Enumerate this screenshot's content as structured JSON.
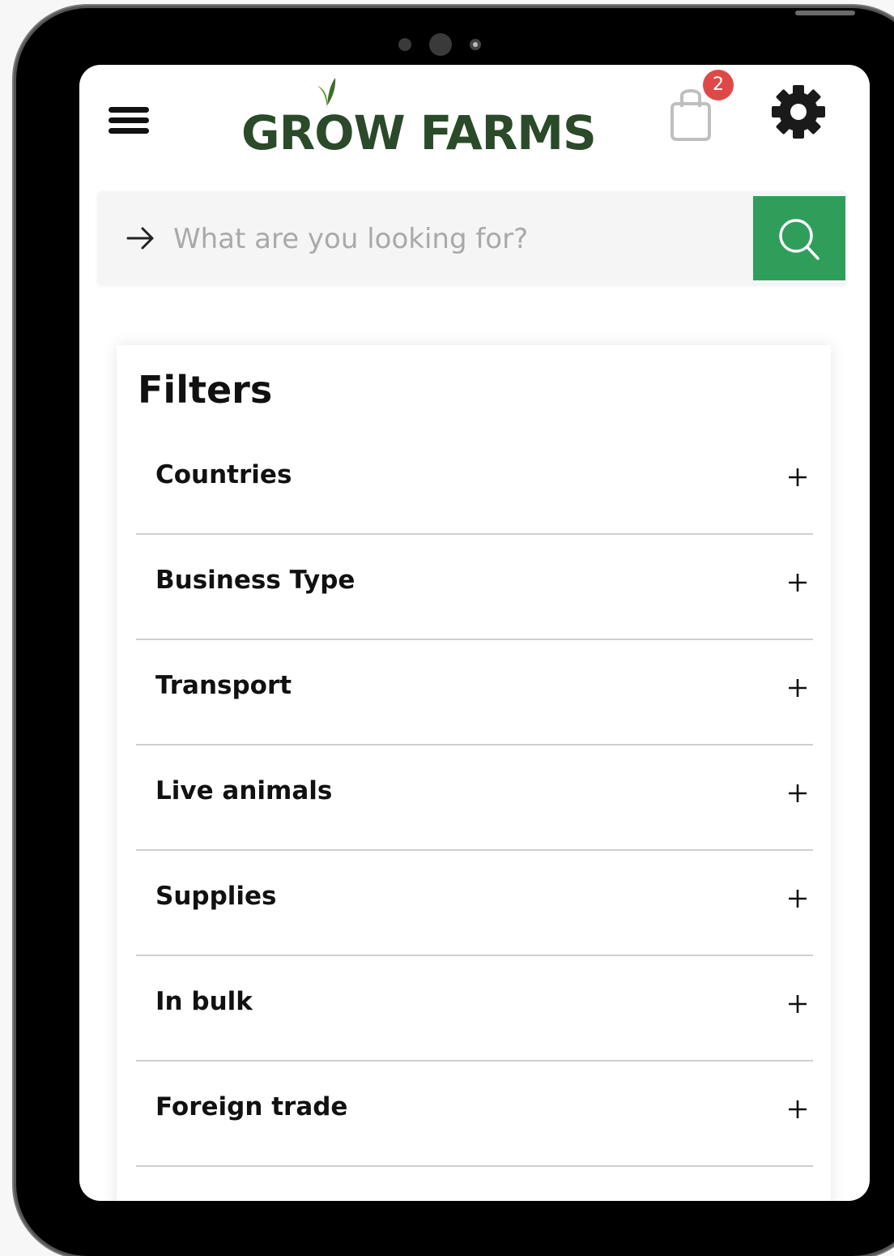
{
  "app": {
    "logo_text": "GROW FARMS"
  },
  "header": {
    "cart_count": "2"
  },
  "search": {
    "placeholder": "What are you looking for?"
  },
  "filters": {
    "title": "Filters",
    "items": [
      {
        "label": "Countries"
      },
      {
        "label": "Business Type"
      },
      {
        "label": "Transport"
      },
      {
        "label": "Live animals"
      },
      {
        "label": "Supplies"
      },
      {
        "label": "In bulk"
      },
      {
        "label": "Foreign trade"
      }
    ]
  },
  "icons": {
    "menu": "hamburger-menu-icon",
    "cart": "shopping-bag-icon",
    "settings": "gear-icon",
    "arrow": "arrow-right-icon",
    "search": "search-icon",
    "expand": "plus-icon"
  },
  "colors": {
    "brand_green": "#2a4a2a",
    "leaf_green": "#6a9a2a",
    "search_button": "#2f9e5b",
    "badge": "#e04848"
  }
}
